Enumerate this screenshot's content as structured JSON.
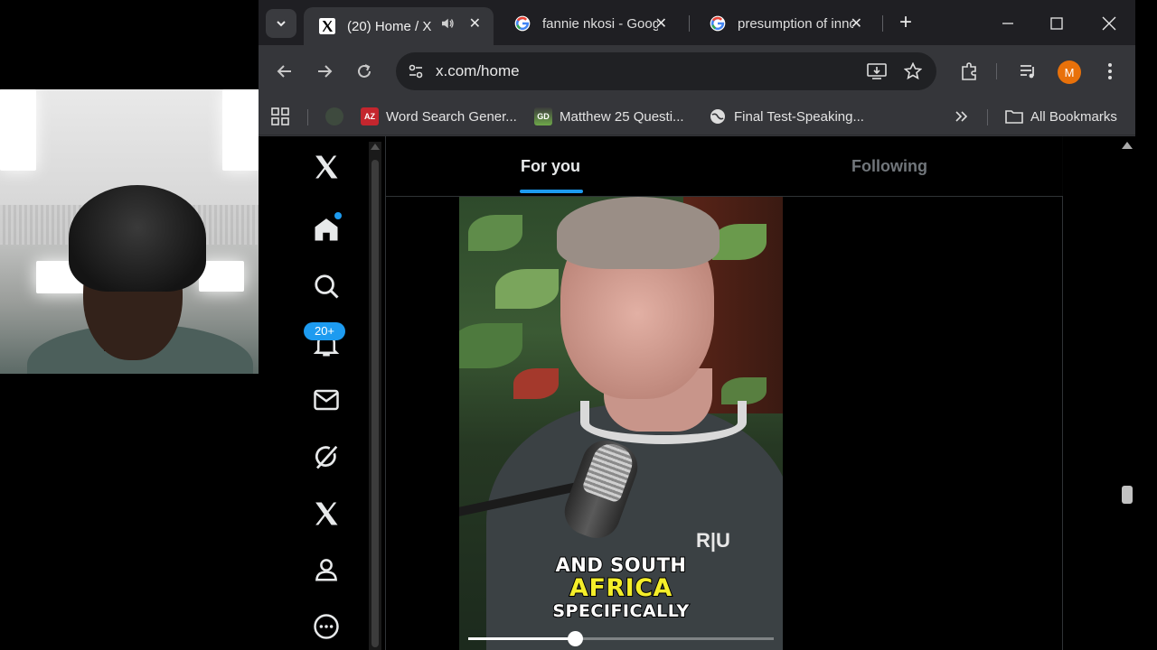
{
  "tabs": [
    {
      "title": "(20) Home / X",
      "favicon": "x-logo-icon",
      "active": true,
      "audio": true
    },
    {
      "title": "fannie nkosi - Google Search",
      "favicon": "google-icon",
      "active": false
    },
    {
      "title": "presumption of innocence - Google Search",
      "favicon": "google-icon",
      "active": false
    }
  ],
  "address_bar": {
    "url": "x.com/home"
  },
  "profile": {
    "initial": "M",
    "color": "#e8710a"
  },
  "bookmarks": [
    {
      "label": "Word Search Gener...",
      "icon": "az-icon"
    },
    {
      "label": "Matthew 25 Questi...",
      "icon": "gd-icon"
    },
    {
      "label": "Final Test-Speaking...",
      "icon": "globe-icon"
    }
  ],
  "all_bookmarks_label": "All Bookmarks",
  "x_sidebar": {
    "notifications_badge": "20+",
    "items": [
      "home-icon",
      "explore-icon",
      "notifications-icon",
      "messages-icon",
      "grok-icon",
      "premium-icon",
      "profile-icon",
      "more-icon"
    ]
  },
  "feed": {
    "tabs": [
      {
        "label": "For you",
        "active": true
      },
      {
        "label": "Following",
        "active": false
      }
    ]
  },
  "video": {
    "caption_line1": "AND SOUTH",
    "caption_line2": "AFRICA",
    "caption_line3": "SPECIFICALLY",
    "watermark": "R|U",
    "progress_fraction": 0.35
  },
  "colors": {
    "accent": "#1d9bf0",
    "caption_highlight": "#f4ee2a",
    "browser_frame": "#35363a"
  }
}
